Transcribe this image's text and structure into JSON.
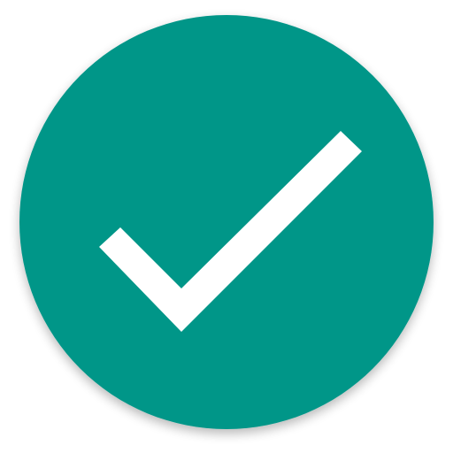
{
  "icon": {
    "name": "check-circle-icon",
    "badge_color": "#009688",
    "shadow_color": "#7a7a7a",
    "mark_color": "#ffffff",
    "background": "#ffffff"
  }
}
